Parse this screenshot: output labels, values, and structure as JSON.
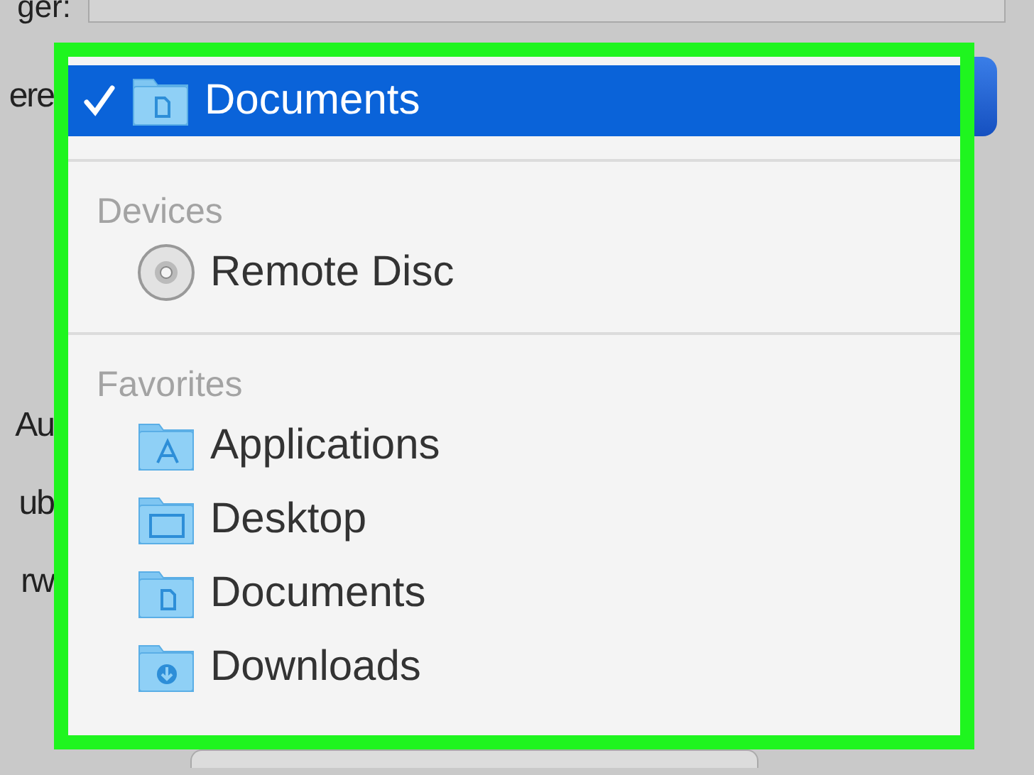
{
  "top_label": "ger:",
  "side_labels": [
    "ere",
    "Au",
    "ub",
    "rw"
  ],
  "menu": {
    "sections": [
      {
        "items": [
          {
            "label": "Documents",
            "kind": "documents",
            "selected": true
          }
        ]
      },
      {
        "header": "Devices",
        "items": [
          {
            "label": "Remote Disc",
            "kind": "disc",
            "selected": false
          }
        ]
      },
      {
        "header": "Favorites",
        "items": [
          {
            "label": "Applications",
            "kind": "applications",
            "selected": false
          },
          {
            "label": "Desktop",
            "kind": "desktop",
            "selected": false
          },
          {
            "label": "Documents",
            "kind": "documents",
            "selected": false
          },
          {
            "label": "Downloads",
            "kind": "downloads",
            "selected": false
          }
        ]
      }
    ]
  }
}
